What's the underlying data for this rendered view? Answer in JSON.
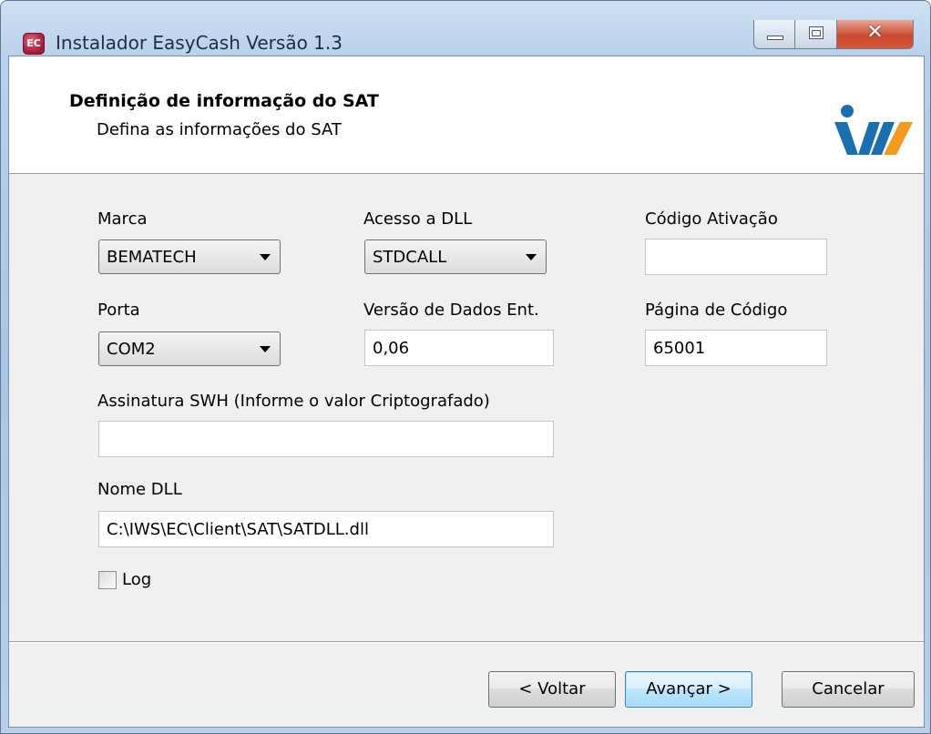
{
  "window": {
    "title": "Instalador EasyCash Versão 1.3",
    "icon_label": "EC"
  },
  "header": {
    "title": "Definição de informação do SAT",
    "subtitle": "Defina as informações do SAT"
  },
  "form": {
    "marca_label": "Marca",
    "marca_value": "BEMATECH",
    "acesso_label": "Acesso a DLL",
    "acesso_value": "STDCALL",
    "codigo_ativacao_label": "Código Ativação",
    "codigo_ativacao_value": "",
    "porta_label": "Porta",
    "porta_value": "COM2",
    "versao_label": "Versão de Dados Ent.",
    "versao_value": "0,06",
    "pagina_label": "Página de Código",
    "pagina_value": "65001",
    "assinatura_label": "Assinatura SWH (Informe o valor Criptografado)",
    "assinatura_value": "",
    "nome_dll_label": "Nome DLL",
    "nome_dll_value": "C:\\IWS\\EC\\Client\\SAT\\SATDLL.dll",
    "log_label": "Log",
    "log_checked": false
  },
  "buttons": {
    "voltar": "< Voltar",
    "avancar": "Avançar >",
    "cancelar": "Cancelar"
  },
  "colors": {
    "logo_blue": "#1a6fb0",
    "logo_orange": "#f39a1e"
  }
}
